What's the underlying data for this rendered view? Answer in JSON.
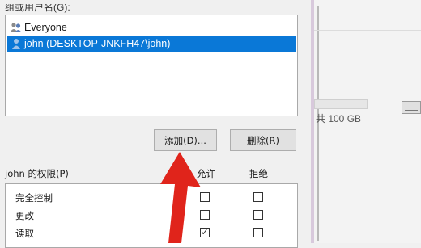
{
  "dialog": {
    "group_header": "组或用户名(G):",
    "principals": [
      {
        "name": "Everyone",
        "selected": false,
        "icon": "group-users-icon"
      },
      {
        "name": "john (DESKTOP-JNKFH47\\john)",
        "selected": true,
        "icon": "user-icon"
      }
    ],
    "add_button": "添加(D)...",
    "remove_button": "删除(R)",
    "permissions_label": "john 的权限(P)",
    "allow_header": "允许",
    "deny_header": "拒绝",
    "permissions": [
      {
        "name": "完全控制",
        "allow": false,
        "deny": false
      },
      {
        "name": "更改",
        "allow": false,
        "deny": false
      },
      {
        "name": "读取",
        "allow": true,
        "deny": false
      }
    ],
    "check_mark": "✓"
  },
  "background_window": {
    "capacity_text": "共 100 GB"
  },
  "annotation": {
    "arrow_color": "#e0241b"
  },
  "colors": {
    "selection": "#0a78d7",
    "button_bg": "#e1e1e1"
  }
}
